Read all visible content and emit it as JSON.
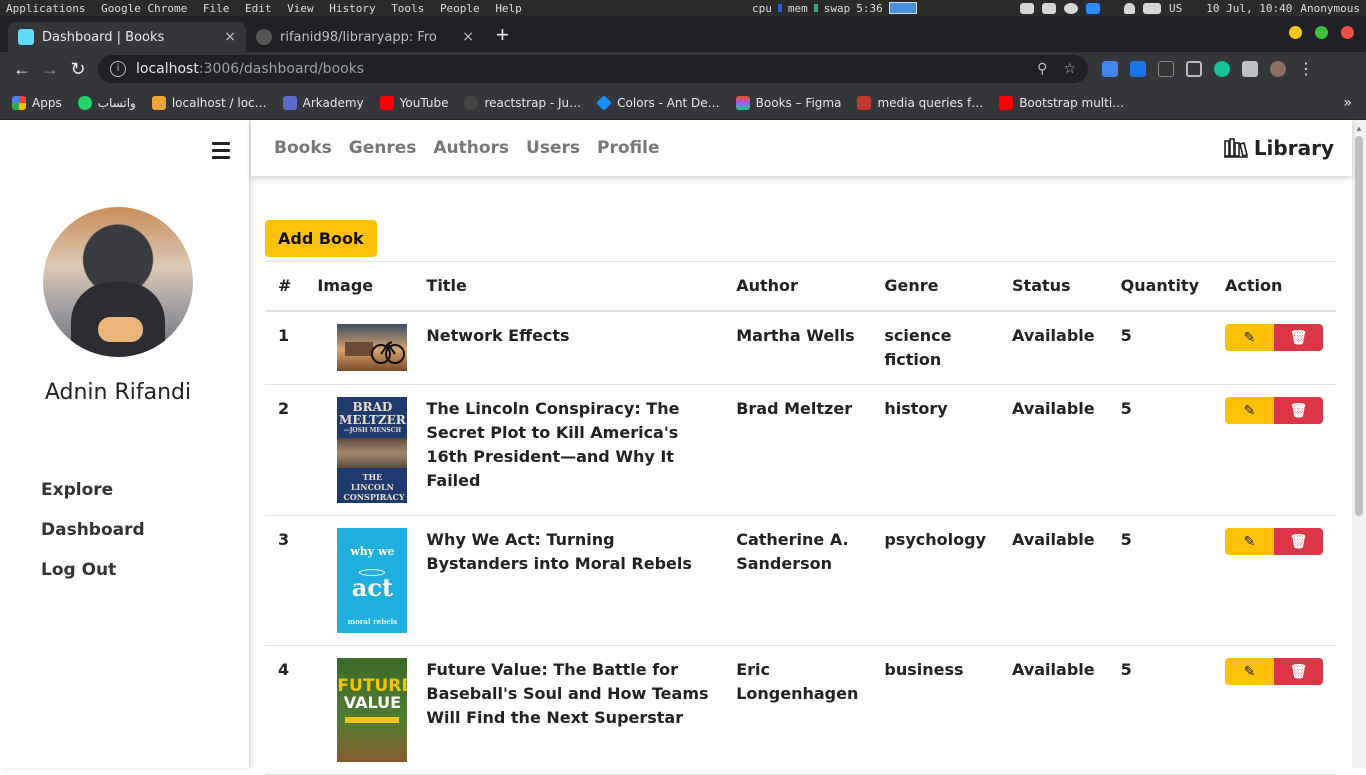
{
  "os": {
    "menus": [
      "Applications",
      "Google Chrome",
      "File",
      "Edit",
      "View",
      "History",
      "Tools",
      "People",
      "Help"
    ],
    "cpu": "cpu",
    "mem": "mem",
    "swap": "swap",
    "time_small": "5:36",
    "lang": "US",
    "datetime": "10 Jul, 10:40",
    "user": "Anonymous"
  },
  "browser": {
    "tabs": [
      {
        "title": "Dashboard | Books",
        "close": "×"
      },
      {
        "title": "rifanid98/libraryapp: Fro",
        "close": "×"
      }
    ],
    "new_tab": "+",
    "url_host": "localhost",
    "url_path": ":3006/dashboard/books",
    "bookmarks": [
      {
        "label": "Apps",
        "color": "#e8453c"
      },
      {
        "label": "واتساب",
        "color": "#25d366"
      },
      {
        "label": "localhost / loc…",
        "color": "#f2a33a"
      },
      {
        "label": "Arkademy",
        "color": "#5b6cc9"
      },
      {
        "label": "YouTube",
        "color": "#ff0000"
      },
      {
        "label": "reactstrap - Ju…",
        "color": "#444444"
      },
      {
        "label": "Colors - Ant De…",
        "color": "#1890ff"
      },
      {
        "label": "Books – Figma",
        "color": "#f24e1e"
      },
      {
        "label": "media queries f…",
        "color": "#c0392b"
      },
      {
        "label": "Bootstrap multi…",
        "color": "#ff0000"
      }
    ],
    "bookmarks_more": "»"
  },
  "sidebar": {
    "username": "Adnin Rifandi",
    "nav": [
      "Explore",
      "Dashboard",
      "Log Out"
    ]
  },
  "topnav": {
    "links": [
      "Books",
      "Genres",
      "Authors",
      "Users",
      "Profile"
    ],
    "brand": "Library"
  },
  "main": {
    "add_label": "Add Book",
    "headers": [
      "#",
      "Image",
      "Title",
      "Author",
      "Genre",
      "Status",
      "Quantity",
      "Action"
    ],
    "rows": [
      {
        "num": "1",
        "title": "Network Effects",
        "author": "Martha Wells",
        "genre": "science fiction",
        "status": "Available",
        "qty": "5"
      },
      {
        "num": "2",
        "title": "The Lincoln Conspiracy: The Secret Plot to Kill America's 16th President—and Why It Failed",
        "author": "Brad Meltzer",
        "genre": "history",
        "status": "Available",
        "qty": "5",
        "cover_author": "BRAD MELTZER",
        "cover_coauthor": "—JOSH MENSCH",
        "cover_title": "THE LINCOLN CONSPIRACY"
      },
      {
        "num": "3",
        "title": "Why We Act: Turning Bystanders into Moral Rebels",
        "author": "Catherine A. Sanderson",
        "genre": "psychology",
        "status": "Available",
        "qty": "5",
        "cover_top": "why we",
        "cover_big": "act",
        "cover_sub": "moral rebels"
      },
      {
        "num": "4",
        "title": "Future Value: The Battle for Baseball's Soul and How Teams Will Find the Next Superstar",
        "author": "Eric Longenhagen",
        "genre": "business",
        "status": "Available",
        "qty": "5",
        "cover_word1": "FUTURE",
        "cover_word2": "VALUE"
      }
    ]
  },
  "colors": {
    "warning": "#ffc107",
    "danger": "#dc3545"
  }
}
